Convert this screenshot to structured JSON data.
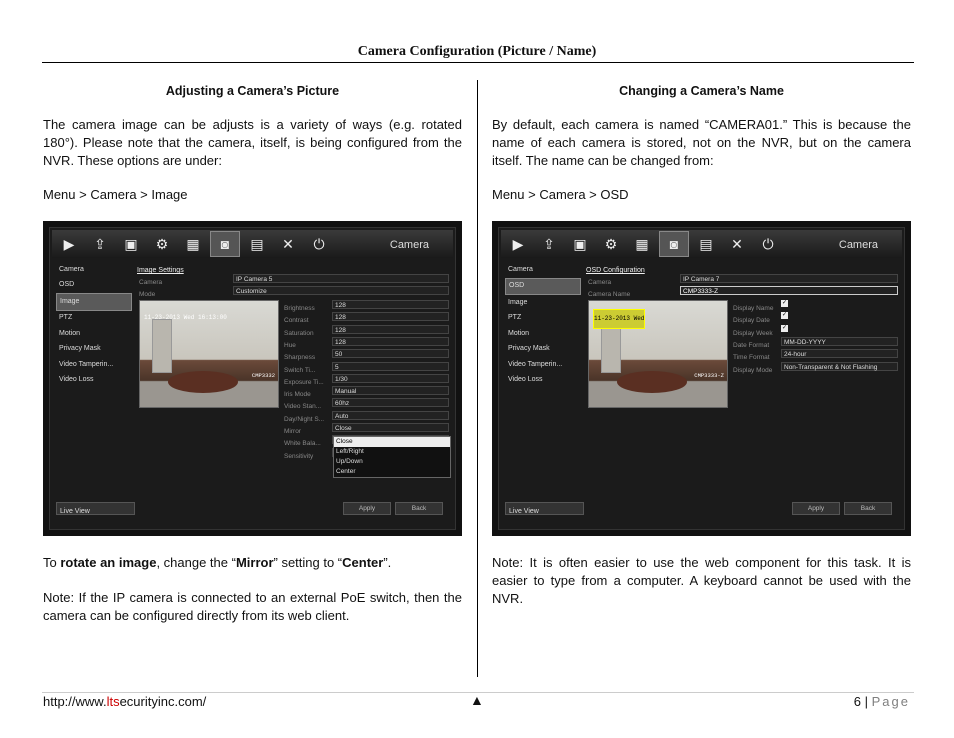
{
  "header": {
    "title": "Camera Configuration (Picture / Name)"
  },
  "left": {
    "heading": "Adjusting a Camera’s Picture",
    "para1": "The camera image can be adjusts is a variety of ways (e.g. rotated 180°). Please note that the camera, itself, is being configured from the NVR. These options are under:",
    "path": "Menu > Camera > Image",
    "para2_pre": "To ",
    "para2_bold1": "rotate an image",
    "para2_mid1": ", change the “",
    "para2_bold2": "Mirror",
    "para2_mid2": "” setting to “",
    "para2_bold3": "Center",
    "para2_end": "”.",
    "para3": "Note: If the IP camera is connected to an external PoE switch, then the camera can be configured directly from its web client.",
    "screen": {
      "title": "Camera",
      "panel_title": "Image Settings",
      "camera_label": "Camera",
      "camera_value": "IP Camera 5",
      "mode_label": "Mode",
      "mode_value": "Customize",
      "osd_time": "11-23-2013 Wed 16:13:00",
      "osd_name": "CMP3332",
      "settings": [
        {
          "label": "Brightness",
          "value": "128"
        },
        {
          "label": "Contrast",
          "value": "128"
        },
        {
          "label": "Saturation",
          "value": "128"
        },
        {
          "label": "Hue",
          "value": "128"
        },
        {
          "label": "Sharpness",
          "value": "50"
        },
        {
          "label": "Switch Ti...",
          "value": "5"
        },
        {
          "label": "Exposure Ti...",
          "value": "1/30"
        },
        {
          "label": "Iris Mode",
          "value": "Manual"
        },
        {
          "label": "Video Stan...",
          "value": "60hz"
        },
        {
          "label": "Day/Night S...",
          "value": "Auto"
        },
        {
          "label": "Mirror",
          "value": "Close"
        },
        {
          "label": "White Bala...",
          "value": ""
        },
        {
          "label": "Sensitivity",
          "value": ""
        }
      ],
      "dropdown_options": [
        "Close",
        "Left/Right",
        "Up/Down",
        "Center"
      ],
      "apply_label": "Apply",
      "back_label": "Back"
    }
  },
  "right": {
    "heading": "Changing a Camera’s Name",
    "para1": "By default, each camera is named “CAMERA01.” This is because the name of each camera is stored, not on the NVR, but on the camera itself. The name can be changed from:",
    "path": "Menu > Camera > OSD",
    "para2": "Note: It is often easier to use the web component for this task. It is easier to type from a computer. A keyboard cannot be used with the NVR.",
    "screen": {
      "title": "Camera",
      "panel_title": "OSD Configuration",
      "camera_label": "Camera",
      "camera_value": "IP Camera 7",
      "name_label": "Camera Name",
      "name_value": "CMP3333-Z",
      "osd_time": "11-23-2013 Wed",
      "osd_name": "CMP3333-Z",
      "settings": [
        {
          "label": "Display Name",
          "value": "✓"
        },
        {
          "label": "Display Date",
          "value": "✓"
        },
        {
          "label": "Display Week",
          "value": "✓"
        },
        {
          "label": "Date Format",
          "value": "MM-DD-YYYY"
        },
        {
          "label": "Time Format",
          "value": "24-hour"
        },
        {
          "label": "Display Mode",
          "value": "Non-Transparent & Not Flashing"
        }
      ],
      "apply_label": "Apply",
      "back_label": "Back"
    }
  },
  "sidebar": [
    "Camera",
    "OSD",
    "Image",
    "PTZ",
    "Motion",
    "Privacy Mask",
    "Video Tamperin...",
    "Video Loss"
  ],
  "live_view": "Live View",
  "footer": {
    "url_pre": "http://www.",
    "url_red": "lts",
    "url_post": "ecurityinc.com/",
    "page_num": "6 | ",
    "page_word": "Page",
    "triangle": "▲"
  }
}
